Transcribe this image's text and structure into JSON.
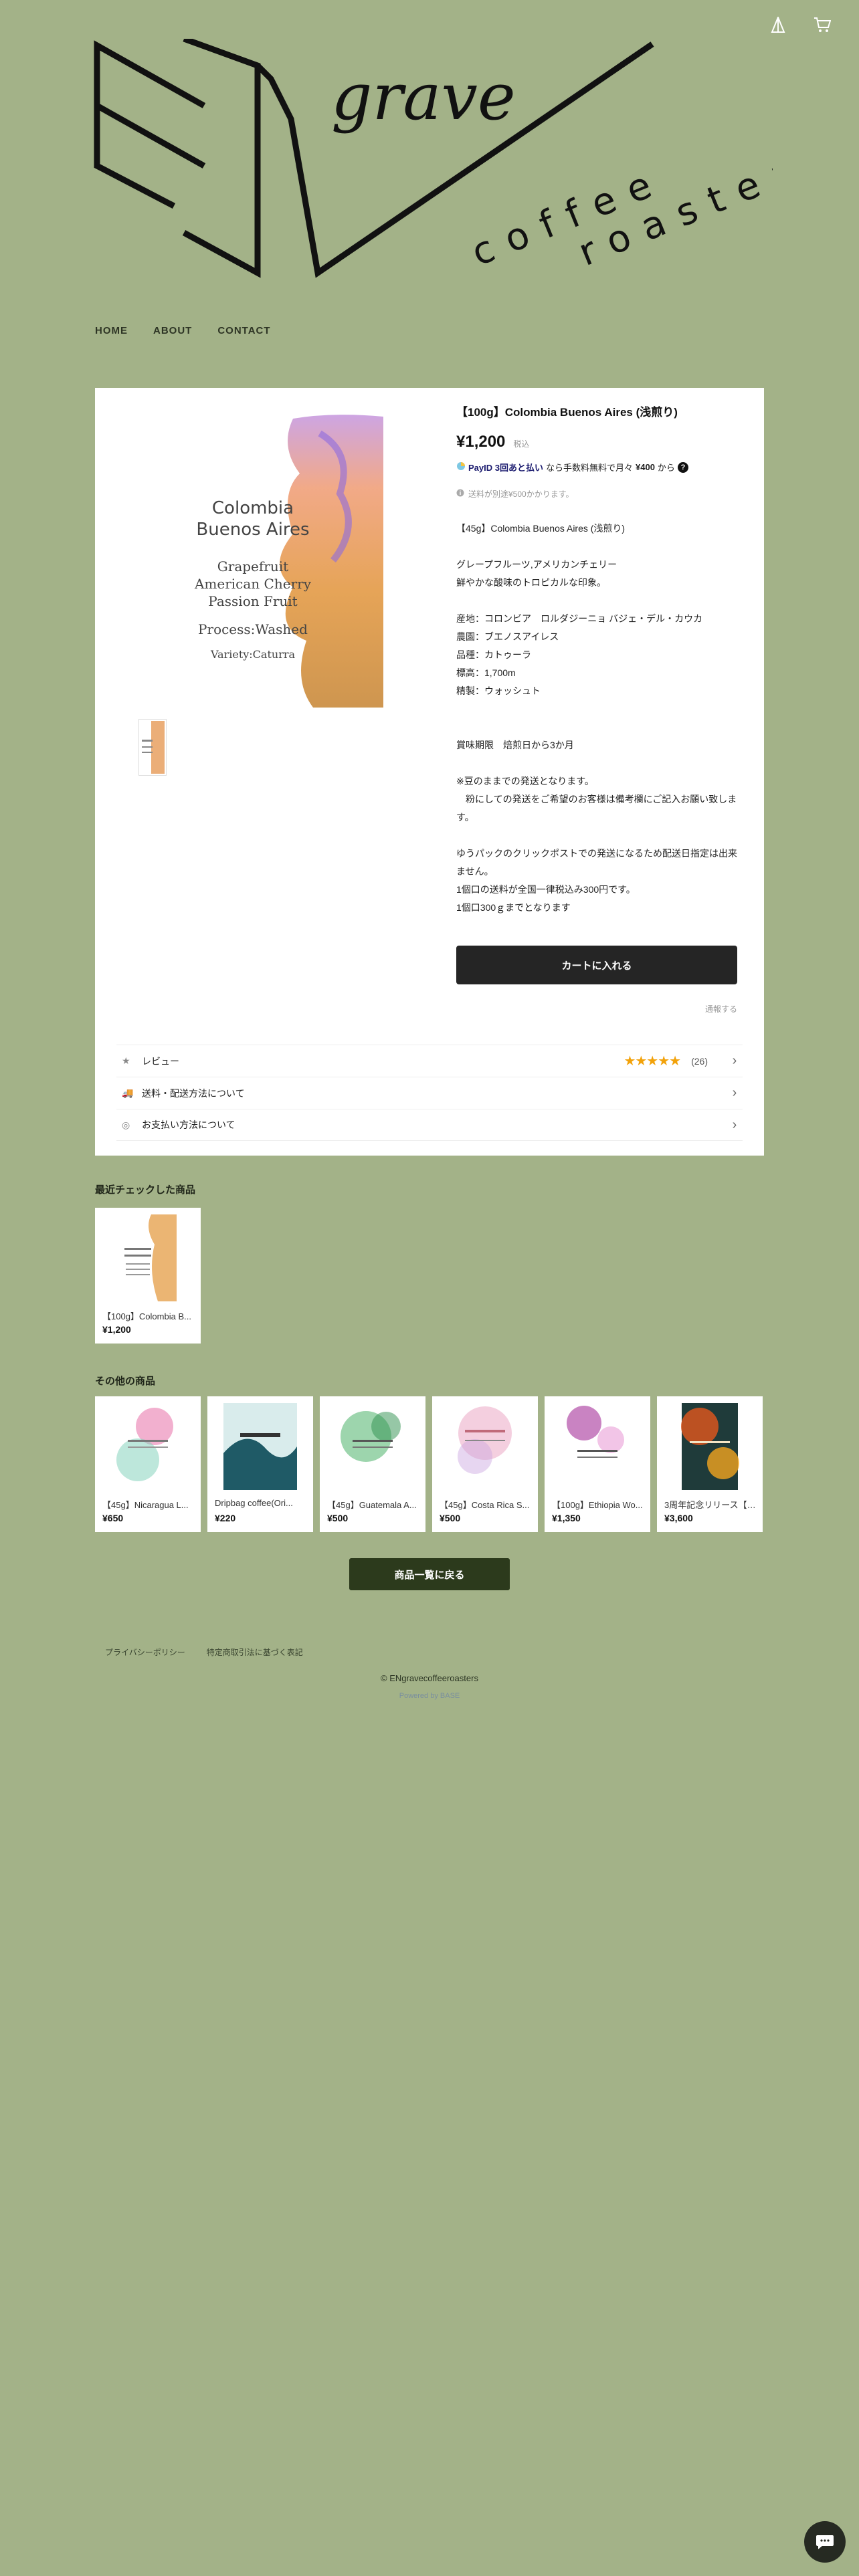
{
  "header": {
    "icons": [
      "base-icon",
      "cart-icon"
    ],
    "nav": [
      "HOME",
      "ABOUT",
      "CONTACT"
    ],
    "logo_text": "ENgrave coffee roasters"
  },
  "product": {
    "image_text": {
      "origin": "Colombia",
      "region": "Buenos Aires",
      "notes1": "Grapefruit",
      "notes2": "American Cherry",
      "notes3": "Passion Fruit",
      "process": "Process:Washed",
      "variety": "Variety:Caturra"
    },
    "title": "【100g】Colombia Buenos Aires (浅煎り)",
    "price": "¥1,200",
    "tax_label": "税込",
    "paid": {
      "brand": "PayID 3回あと払い",
      "text": "なら手数料無料で月々",
      "amount": "¥400",
      "suffix": "から",
      "help": "?"
    },
    "shipping_note": "送料が別途¥500かかります。",
    "description": [
      "【45g】Colombia Buenos Aires (浅煎り)",
      "",
      "グレープフルーツ,アメリカンチェリー",
      "鮮やかな酸味のトロピカルな印象。",
      "",
      "産地：コロンビア　ロルダジーニョ バジェ・デル・カウカ",
      "農園：ブエノスアイレス",
      "品種：カトゥーラ",
      "標高：1,700m",
      "精製：ウォッシュト",
      "",
      "",
      "賞味期限　焙煎日から3か月",
      "",
      "※豆のままでの発送となります。",
      "　粉にしての発送をご希望のお客様は備考欄にご記入お願い致します。",
      "",
      "ゆうパックのクリックポストでの発送になるため配送日指定は出来ません。",
      "1個口の送料が全国一律税込み300円です。",
      "1個口300ｇまでとなります"
    ],
    "cart_button": "カートに入れる",
    "report": "通報する",
    "accordion": {
      "reviews": "レビュー",
      "review_count": "(26)",
      "rating": 5,
      "shipping": "送料・配送方法について",
      "payment": "お支払い方法について"
    }
  },
  "recent": {
    "title": "最近チェックした商品",
    "items": [
      {
        "name": "【100g】Colombia B...",
        "price": "¥1,200",
        "color": "#e8a85a"
      }
    ]
  },
  "others": {
    "title": "その他の商品",
    "items": [
      {
        "name": "【45g】Nicaragua L...",
        "price": "¥650",
        "color": "#e76fa8",
        "art_title": "Nicaragua"
      },
      {
        "name": "Dripbag coffee(Ori...",
        "price": "¥220",
        "color": "#1f5a66",
        "art_title": "Foggy night"
      },
      {
        "name": "【45g】Guatemala A...",
        "price": "¥500",
        "color": "#4cb36a",
        "art_title": "Guatemala"
      },
      {
        "name": "【45g】Costa Rica S...",
        "price": "¥500",
        "color": "#e9a0c0",
        "art_title": "Costa Rica"
      },
      {
        "name": "【100g】Ethiopia Wo...",
        "price": "¥1,350",
        "color": "#b24ea8",
        "art_title": "Ethiopia"
      },
      {
        "name": "3周年記念リリース【3...",
        "price": "¥3,600",
        "color": "#d8561f",
        "art_title": "Anniversary"
      }
    ]
  },
  "back_button": "商品一覧に戻る",
  "footer": {
    "links": [
      "プライバシーポリシー",
      "特定商取引法に基づく表記"
    ],
    "copyright": "© ENgravecoffeeroasters",
    "powered": "Powered by BASE"
  }
}
